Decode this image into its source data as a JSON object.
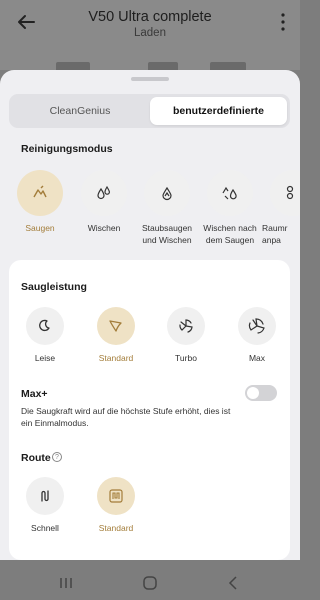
{
  "header": {
    "title": "V50 Ultra complete",
    "subtitle": "Laden"
  },
  "tabs": {
    "clean_genius": "CleanGenius",
    "custom": "benutzerdefinierte",
    "active": "custom"
  },
  "cleaning_mode": {
    "title": "Reinigungsmodus",
    "items": [
      {
        "label": "Saugen",
        "icon": "vacuum-icon",
        "selected": true
      },
      {
        "label": "Wischen",
        "icon": "water-drops-icon",
        "selected": false
      },
      {
        "label": "Staubsaugen und Wischen",
        "icon": "vacuum-and-mop-icon",
        "selected": false
      },
      {
        "label": "Wischen nach dem Saugen",
        "icon": "mop-after-vacuum-icon",
        "selected": false
      },
      {
        "label": "Raumr anpa",
        "icon": "room-icon",
        "selected": false
      }
    ]
  },
  "suction": {
    "title": "Saugleistung",
    "items": [
      {
        "label": "Leise",
        "icon": "quiet-fan-icon",
        "selected": false
      },
      {
        "label": "Standard",
        "icon": "standard-fan-icon",
        "selected": true
      },
      {
        "label": "Turbo",
        "icon": "turbo-fan-icon",
        "selected": false
      },
      {
        "label": "Max",
        "icon": "max-fan-icon",
        "selected": false
      }
    ]
  },
  "max_plus": {
    "title": "Max+",
    "description": "Die Saugkraft wird auf die höchste Stufe erhöht, dies ist ein Einmalmodus.",
    "enabled": false
  },
  "route": {
    "title": "Route",
    "items": [
      {
        "label": "Schnell",
        "icon": "quick-route-icon",
        "selected": false
      },
      {
        "label": "Standard",
        "icon": "standard-route-icon",
        "selected": true
      }
    ]
  },
  "colors": {
    "accent": "#a37d3a",
    "accent_bg": "#efe2c5"
  }
}
